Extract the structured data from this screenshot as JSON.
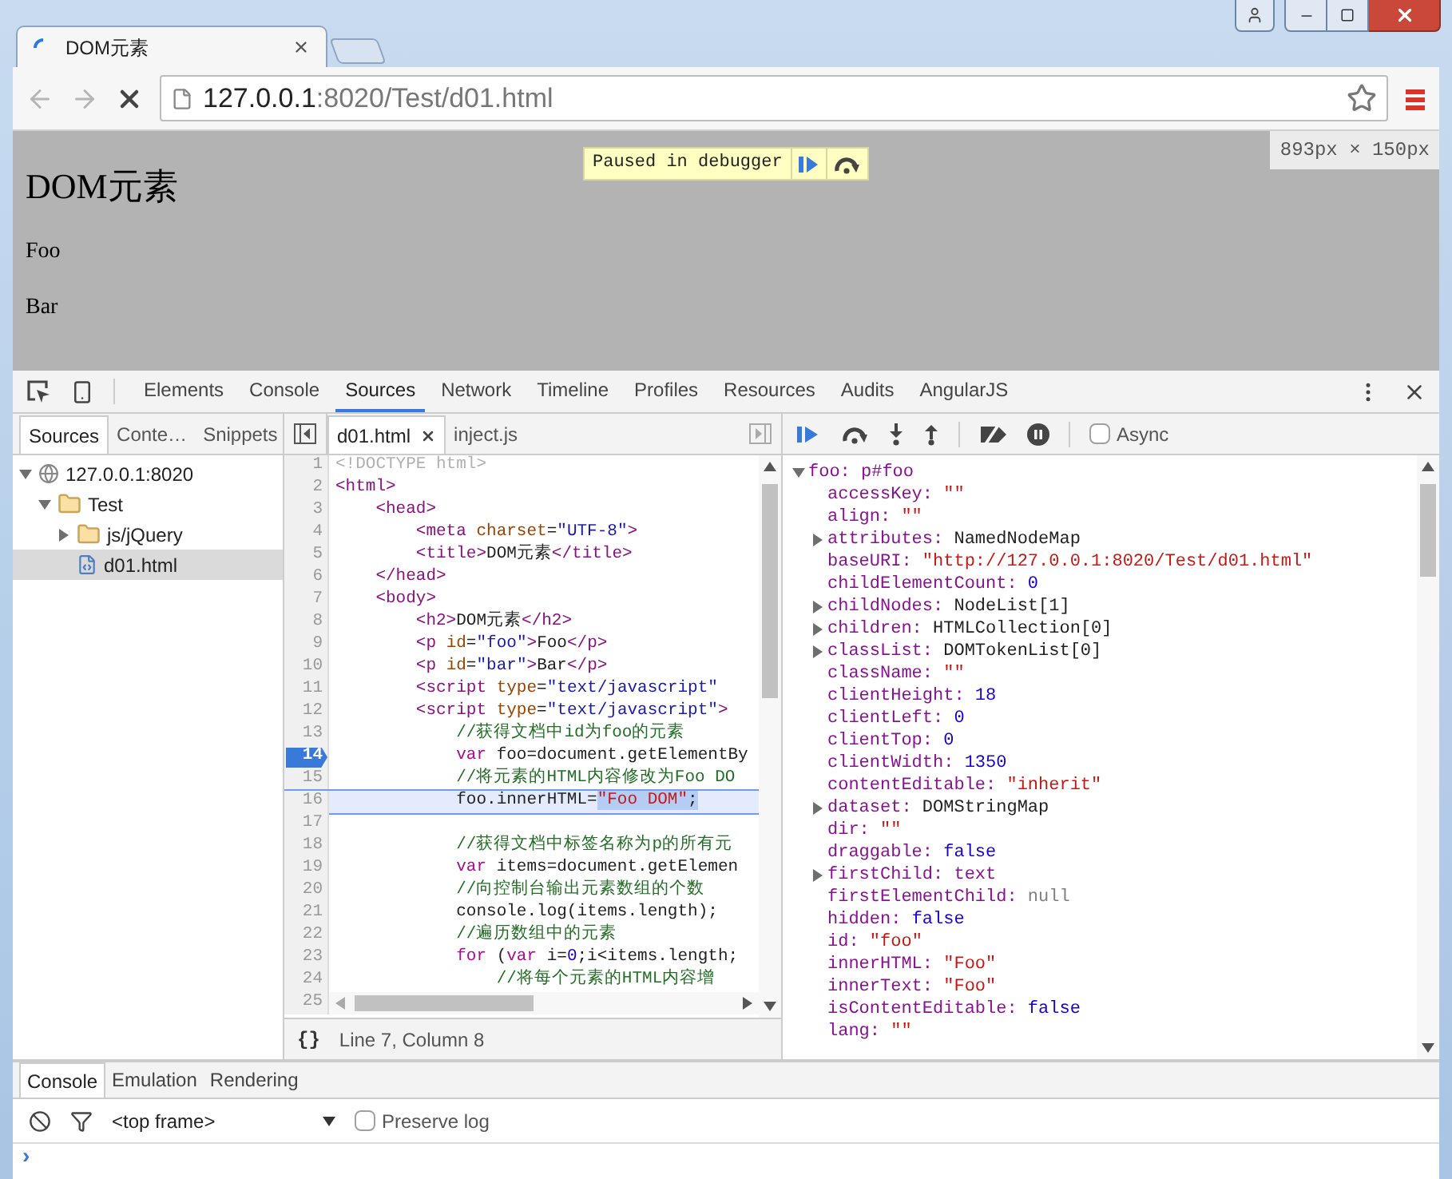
{
  "browser": {
    "tabs": [
      {
        "title": "DOM元素",
        "selected": true,
        "loading": true
      }
    ],
    "address": {
      "host": "127.0.0.1",
      "path": ":8020/Test/d01.html"
    }
  },
  "page": {
    "heading": "DOM元素",
    "paragraphs": [
      "Foo",
      "Bar"
    ],
    "paused_banner": "Paused in debugger",
    "size_badge": "893px × 150px"
  },
  "devtools": {
    "tabs": [
      {
        "label": "Elements",
        "selected": false
      },
      {
        "label": "Console",
        "selected": false
      },
      {
        "label": "Sources",
        "selected": true
      },
      {
        "label": "Network",
        "selected": false
      },
      {
        "label": "Timeline",
        "selected": false
      },
      {
        "label": "Profiles",
        "selected": false
      },
      {
        "label": "Resources",
        "selected": false
      },
      {
        "label": "Audits",
        "selected": false
      },
      {
        "label": "AngularJS",
        "selected": false
      }
    ]
  },
  "navigator": {
    "tabs": [
      {
        "label": "Sources",
        "selected": true
      },
      {
        "label": "Conte…",
        "selected": false
      },
      {
        "label": "Snippets",
        "selected": false
      }
    ],
    "tree": [
      {
        "label": "127.0.0.1:8020",
        "kind": "origin",
        "expanded": true,
        "selected": false,
        "children": [
          {
            "label": "Test",
            "kind": "folder",
            "expanded": true,
            "selected": false,
            "children": [
              {
                "label": "js/jQuery",
                "kind": "folder",
                "expanded": false,
                "selected": false
              },
              {
                "label": "d01.html",
                "kind": "file",
                "selected": true
              }
            ]
          }
        ]
      }
    ]
  },
  "editor": {
    "tabs": [
      {
        "label": "d01.html",
        "selected": true,
        "closable": true
      },
      {
        "label": "inject.js",
        "selected": false,
        "closable": false
      }
    ],
    "lines": [
      {
        "number": "1",
        "breakpoint": false,
        "current": false,
        "tokens": [
          {
            "kind": "doctype",
            "text": "<!DOCTYPE html>"
          }
        ]
      },
      {
        "number": "2",
        "breakpoint": false,
        "current": false,
        "tokens": [
          {
            "kind": "tag",
            "text": "<html>"
          }
        ]
      },
      {
        "number": "3",
        "breakpoint": false,
        "current": false,
        "tokens": [
          {
            "kind": "tag",
            "text": "    <head>"
          }
        ]
      },
      {
        "number": "4",
        "breakpoint": false,
        "current": false,
        "tokens": [
          {
            "kind": "tag",
            "text": "        <meta"
          },
          {
            "kind": "attr",
            "text": " charset"
          },
          {
            "kind": "plain",
            "text": "="
          },
          {
            "kind": "val",
            "text": "\"UTF-8\""
          },
          {
            "kind": "tag",
            "text": ">"
          }
        ]
      },
      {
        "number": "5",
        "breakpoint": false,
        "current": false,
        "tokens": [
          {
            "kind": "tag",
            "text": "        <title>"
          },
          {
            "kind": "plain",
            "text": "DOM元素"
          },
          {
            "kind": "tag",
            "text": "</title>"
          }
        ]
      },
      {
        "number": "6",
        "breakpoint": false,
        "current": false,
        "tokens": [
          {
            "kind": "tag",
            "text": "    </head>"
          }
        ]
      },
      {
        "number": "7",
        "breakpoint": false,
        "current": false,
        "tokens": [
          {
            "kind": "tag",
            "text": "    <body>"
          }
        ]
      },
      {
        "number": "8",
        "breakpoint": false,
        "current": false,
        "tokens": [
          {
            "kind": "tag",
            "text": "        <h2>"
          },
          {
            "kind": "plain",
            "text": "DOM元素"
          },
          {
            "kind": "tag",
            "text": "</h2>"
          }
        ]
      },
      {
        "number": "9",
        "breakpoint": false,
        "current": false,
        "tokens": [
          {
            "kind": "tag",
            "text": "        <p"
          },
          {
            "kind": "attr",
            "text": " id"
          },
          {
            "kind": "plain",
            "text": "="
          },
          {
            "kind": "val",
            "text": "\"foo\""
          },
          {
            "kind": "tag",
            "text": ">"
          },
          {
            "kind": "plain",
            "text": "Foo"
          },
          {
            "kind": "tag",
            "text": "</p>"
          }
        ]
      },
      {
        "number": "10",
        "breakpoint": false,
        "current": false,
        "tokens": [
          {
            "kind": "tag",
            "text": "        <p"
          },
          {
            "kind": "attr",
            "text": " id"
          },
          {
            "kind": "plain",
            "text": "="
          },
          {
            "kind": "val",
            "text": "\"bar\""
          },
          {
            "kind": "tag",
            "text": ">"
          },
          {
            "kind": "plain",
            "text": "Bar"
          },
          {
            "kind": "tag",
            "text": "</p>"
          }
        ]
      },
      {
        "number": "11",
        "breakpoint": false,
        "current": false,
        "tokens": [
          {
            "kind": "tag",
            "text": "        <script"
          },
          {
            "kind": "attr",
            "text": " type"
          },
          {
            "kind": "plain",
            "text": "="
          },
          {
            "kind": "val",
            "text": "\"text/javascript\""
          }
        ]
      },
      {
        "number": "12",
        "breakpoint": false,
        "current": false,
        "tokens": [
          {
            "kind": "tag",
            "text": "        <script"
          },
          {
            "kind": "attr",
            "text": " type"
          },
          {
            "kind": "plain",
            "text": "="
          },
          {
            "kind": "val",
            "text": "\"text/javascript\""
          },
          {
            "kind": "tag",
            "text": ">"
          }
        ]
      },
      {
        "number": "13",
        "breakpoint": false,
        "current": false,
        "tokens": [
          {
            "kind": "comment",
            "text": "            //获得文档中id为foo的元素"
          }
        ]
      },
      {
        "number": "14",
        "breakpoint": true,
        "current": false,
        "tokens": [
          {
            "kind": "keyword",
            "text": "            var"
          },
          {
            "kind": "plain",
            "text": " foo=document.getElementBy"
          }
        ]
      },
      {
        "number": "15",
        "breakpoint": false,
        "current": false,
        "tokens": [
          {
            "kind": "comment",
            "text": "            //将元素的HTML内容修改为Foo DO"
          }
        ]
      },
      {
        "number": "16",
        "breakpoint": false,
        "current": true,
        "tokens": [
          {
            "kind": "plain",
            "text": "            foo.innerHTML="
          },
          {
            "kind": "jsstr",
            "text": "\"Foo DOM\""
          },
          {
            "kind": "plain",
            "text": ";"
          }
        ]
      },
      {
        "number": "17",
        "breakpoint": false,
        "current": false
      },
      {
        "number": "18",
        "breakpoint": false,
        "current": false,
        "tokens": [
          {
            "kind": "comment",
            "text": "            //获得文档中标签名称为p的所有元"
          }
        ]
      },
      {
        "number": "19",
        "breakpoint": false,
        "current": false,
        "tokens": [
          {
            "kind": "keyword",
            "text": "            var"
          },
          {
            "kind": "plain",
            "text": " items=document.getElemen"
          }
        ]
      },
      {
        "number": "20",
        "breakpoint": false,
        "current": false,
        "tokens": [
          {
            "kind": "comment",
            "text": "            //向控制台输出元素数组的个数"
          }
        ]
      },
      {
        "number": "21",
        "breakpoint": false,
        "current": false,
        "tokens": [
          {
            "kind": "plain",
            "text": "            console.log(items.length);"
          }
        ]
      },
      {
        "number": "22",
        "breakpoint": false,
        "current": false,
        "tokens": [
          {
            "kind": "comment",
            "text": "            //遍历数组中的元素"
          }
        ]
      },
      {
        "number": "23",
        "breakpoint": false,
        "current": false,
        "tokens": [
          {
            "kind": "keyword",
            "text": "            for"
          },
          {
            "kind": "plain",
            "text": " ("
          },
          {
            "kind": "keyword",
            "text": "var"
          },
          {
            "kind": "plain",
            "text": " i="
          },
          {
            "kind": "num",
            "text": "0"
          },
          {
            "kind": "plain",
            "text": ";i<items.length;"
          }
        ]
      },
      {
        "number": "24",
        "breakpoint": false,
        "current": false,
        "tokens": [
          {
            "kind": "comment",
            "text": "                //将每个元素的HTML内容增"
          }
        ]
      },
      {
        "number": "25",
        "breakpoint": false,
        "current": false
      }
    ],
    "pretty_print": "{}",
    "status": "Line 7, Column 8"
  },
  "debugger": {
    "async": {
      "label": "Async",
      "checked": false
    },
    "scope": {
      "name": "foo:",
      "value": "p#foo",
      "expanded": true,
      "properties": [
        {
          "name": "accessKey:",
          "value": "\"\"",
          "kind": "str",
          "expandable": false
        },
        {
          "name": "align:",
          "value": "\"\"",
          "kind": "str",
          "expandable": false
        },
        {
          "name": "attributes:",
          "value": "NamedNodeMap",
          "kind": "obj",
          "expandable": true
        },
        {
          "name": "baseURI:",
          "value": "\"http://127.0.0.1:8020/Test/d01.html\"",
          "kind": "str",
          "expandable": false
        },
        {
          "name": "childElementCount:",
          "value": "0",
          "kind": "num",
          "expandable": false
        },
        {
          "name": "childNodes:",
          "value": "NodeList[1]",
          "kind": "obj",
          "expandable": true
        },
        {
          "name": "children:",
          "value": "HTMLCollection[0]",
          "kind": "obj",
          "expandable": true
        },
        {
          "name": "classList:",
          "value": "DOMTokenList[0]",
          "kind": "obj",
          "expandable": true
        },
        {
          "name": "className:",
          "value": "\"\"",
          "kind": "str",
          "expandable": false
        },
        {
          "name": "clientHeight:",
          "value": "18",
          "kind": "num",
          "expandable": false
        },
        {
          "name": "clientLeft:",
          "value": "0",
          "kind": "num",
          "expandable": false
        },
        {
          "name": "clientTop:",
          "value": "0",
          "kind": "num",
          "expandable": false
        },
        {
          "name": "clientWidth:",
          "value": "1350",
          "kind": "num",
          "expandable": false
        },
        {
          "name": "contentEditable:",
          "value": "\"inherit\"",
          "kind": "str",
          "expandable": false
        },
        {
          "name": "dataset:",
          "value": "DOMStringMap",
          "kind": "obj",
          "expandable": true
        },
        {
          "name": "dir:",
          "value": "\"\"",
          "kind": "str",
          "expandable": false
        },
        {
          "name": "draggable:",
          "value": "false",
          "kind": "bool",
          "expandable": false
        },
        {
          "name": "firstChild:",
          "value": "text",
          "kind": "node",
          "expandable": true
        },
        {
          "name": "firstElementChild:",
          "value": "null",
          "kind": "null",
          "expandable": false
        },
        {
          "name": "hidden:",
          "value": "false",
          "kind": "bool",
          "expandable": false
        },
        {
          "name": "id:",
          "value": "\"foo\"",
          "kind": "str",
          "expandable": false
        },
        {
          "name": "innerHTML:",
          "value": "\"Foo\"",
          "kind": "str",
          "expandable": false
        },
        {
          "name": "innerText:",
          "value": "\"Foo\"",
          "kind": "str",
          "expandable": false
        },
        {
          "name": "isContentEditable:",
          "value": "false",
          "kind": "bool",
          "expandable": false
        },
        {
          "name": "lang:",
          "value": "\"\"",
          "kind": "str",
          "expandable": false
        }
      ]
    }
  },
  "drawer": {
    "tabs": [
      {
        "label": "Console",
        "selected": true
      },
      {
        "label": "Emulation",
        "selected": false
      },
      {
        "label": "Rendering",
        "selected": false
      }
    ],
    "frame_select": "<top frame>",
    "preserve_log": {
      "label": "Preserve log",
      "checked": false
    },
    "prompt": "›"
  }
}
